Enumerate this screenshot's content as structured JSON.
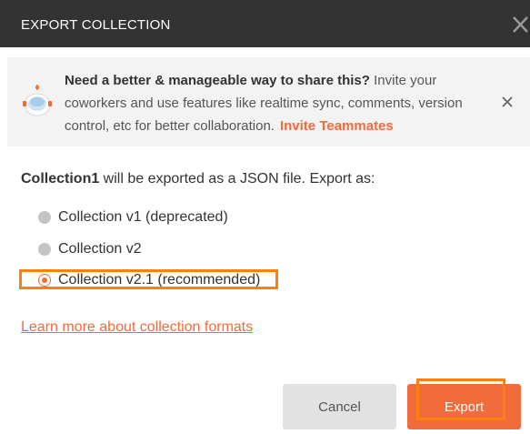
{
  "dialog": {
    "title": "EXPORT COLLECTION",
    "close_icon": "close-icon"
  },
  "banner": {
    "icon": "astronaut-icon",
    "heading": "Need a better & manageable way to share this?",
    "body": " Invite your coworkers and use features like realtime sync, comments, version control, etc for better collaboration.",
    "invite_link": "Invite Teammates",
    "close_icon": "close-icon"
  },
  "export": {
    "collection_name": "Collection1",
    "intro_suffix": " will be exported as a JSON file. Export as:",
    "options": [
      {
        "label": "Collection v1 (deprecated)",
        "selected": false
      },
      {
        "label": "Collection v2",
        "selected": false
      },
      {
        "label": "Collection v2.1 (recommended)",
        "selected": true
      }
    ],
    "learn_more": "Learn more about collection formats"
  },
  "buttons": {
    "cancel": "Cancel",
    "export": "Export"
  },
  "colors": {
    "accent": "#f26b3a",
    "header_bg": "#333333",
    "highlight": "#ff7f0e"
  }
}
